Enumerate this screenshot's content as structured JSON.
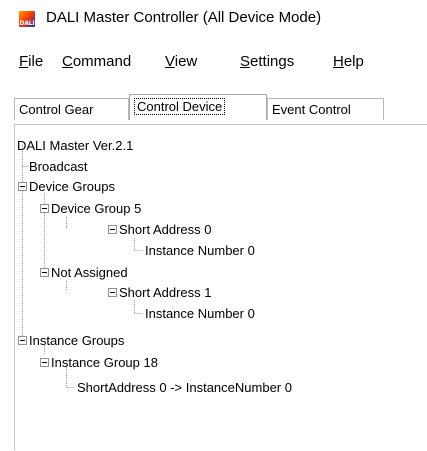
{
  "window": {
    "title": "DALI Master Controller (All Device Mode)",
    "icon": "dali-app-icon",
    "icon_text": "DALI"
  },
  "menu": {
    "items": [
      {
        "first": "F",
        "rest": "ile"
      },
      {
        "first": "C",
        "rest": "ommand"
      },
      {
        "first": "V",
        "rest": "iew"
      },
      {
        "first": "S",
        "rest": "ettings"
      },
      {
        "first": "H",
        "rest": "elp"
      }
    ]
  },
  "tabs": [
    {
      "label": "Control Gear"
    },
    {
      "label": "Control Device",
      "selected": true
    },
    {
      "label": "Event Control"
    }
  ],
  "tree": {
    "root": "DALI Master Ver.2.1",
    "broadcast": "Broadcast",
    "device_groups": "Device Groups",
    "device_group_5": "Device Group 5",
    "dg5_short_address": "Short Address 0",
    "dg5_instance": "Instance Number 0",
    "not_assigned": "Not Assigned",
    "na_short_address": "Short Address 1",
    "na_instance": "Instance Number 0",
    "instance_groups": "Instance Groups",
    "instance_group_18": "Instance Group 18",
    "ig18_mapping": "ShortAddress 0 -> InstanceNumber 0"
  },
  "colors": {
    "tree_line": "#a0a0a0",
    "tab_border": "#b9b9b9"
  }
}
